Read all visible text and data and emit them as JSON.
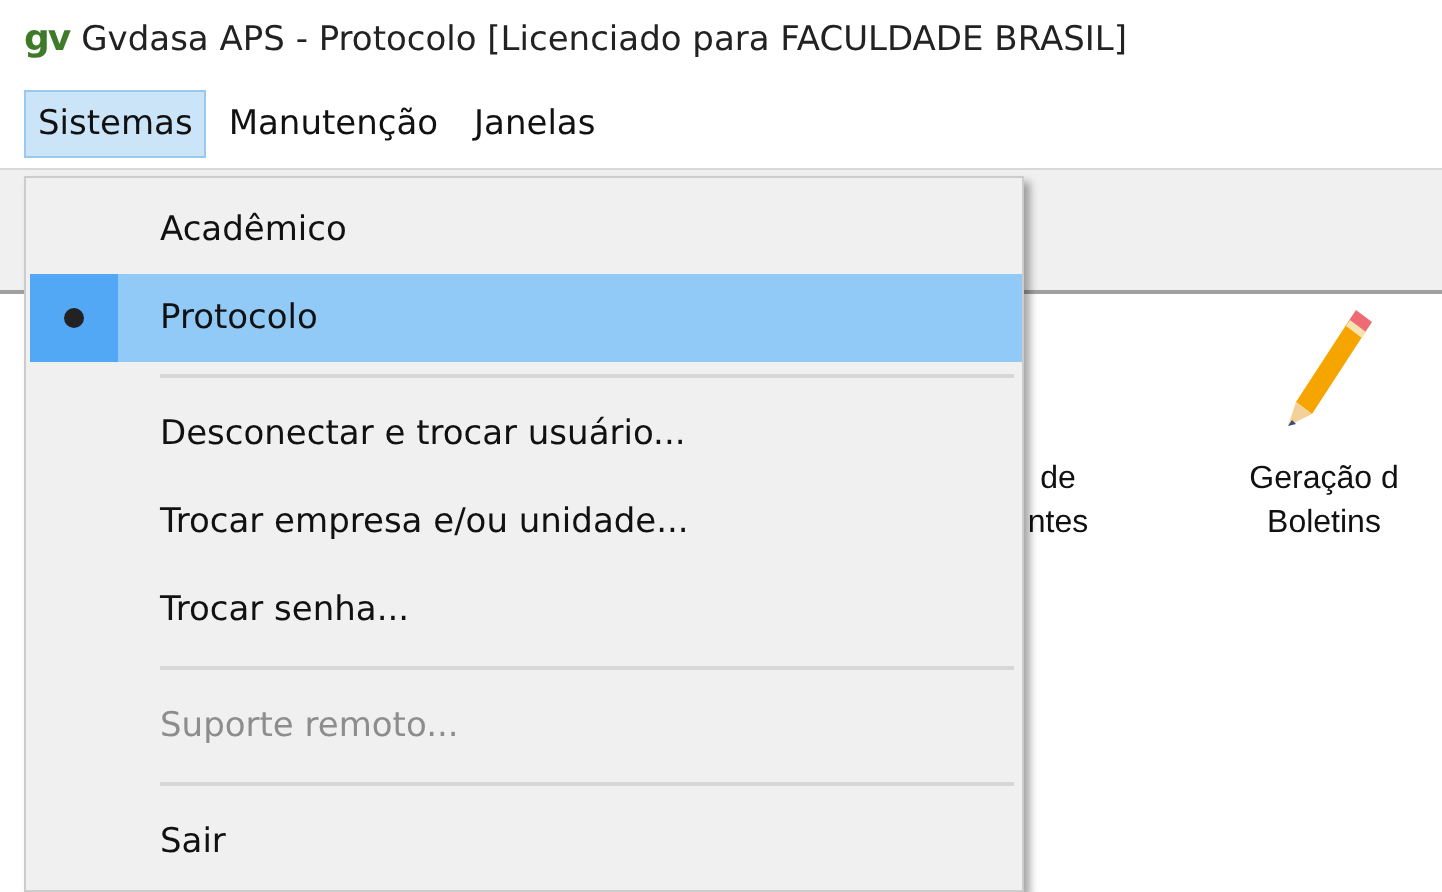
{
  "window": {
    "logo": "gv",
    "title": "Gvdasa APS - Protocolo [Licenciado para FACULDADE BRASIL]"
  },
  "menubar": [
    {
      "label": "Sistemas",
      "selected": true
    },
    {
      "label": "Manutenção",
      "selected": false
    },
    {
      "label": "Janelas",
      "selected": false
    }
  ],
  "dropdown": [
    {
      "kind": "item",
      "label": "Acadêmico",
      "selected": false,
      "disabled": false
    },
    {
      "kind": "item",
      "label": "Protocolo",
      "selected": true,
      "disabled": false
    },
    {
      "kind": "separator"
    },
    {
      "kind": "item",
      "label": "Desconectar e trocar usuário...",
      "selected": false,
      "disabled": false
    },
    {
      "kind": "item",
      "label": "Trocar empresa e/ou unidade...",
      "selected": false,
      "disabled": false
    },
    {
      "kind": "item",
      "label": "Trocar senha...",
      "selected": false,
      "disabled": false
    },
    {
      "kind": "separator"
    },
    {
      "kind": "item",
      "label": "Suporte remoto...",
      "selected": false,
      "disabled": true
    },
    {
      "kind": "separator"
    },
    {
      "kind": "item",
      "label": "Sair",
      "selected": false,
      "disabled": false
    }
  ],
  "desktop_icons": [
    {
      "kind": "hidden",
      "lines": [
        "de",
        "ntes"
      ]
    },
    {
      "kind": "pencil",
      "lines": [
        "Geração d",
        "Boletins"
      ]
    }
  ]
}
